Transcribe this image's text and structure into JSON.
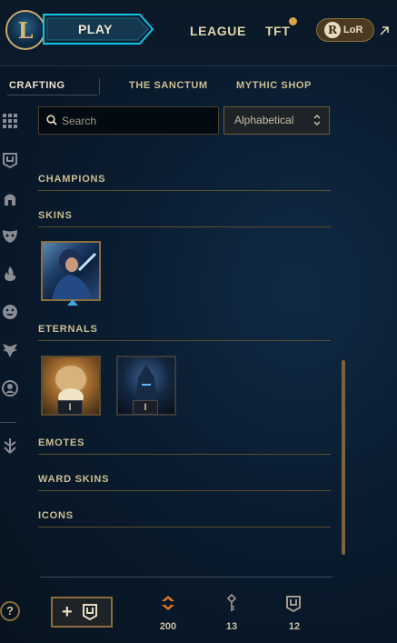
{
  "header": {
    "play_label": "PLAY",
    "nav": [
      {
        "label": "LEAGUE"
      },
      {
        "label": "TFT"
      }
    ],
    "lor_label": "LoR",
    "lor_badge": "R"
  },
  "subnav": {
    "tabs": [
      {
        "label": "CRAFTING",
        "active": true
      },
      {
        "label": "THE SANCTUM",
        "active": false
      },
      {
        "label": "MYTHIC SHOP",
        "active": false
      }
    ]
  },
  "search": {
    "placeholder": "Search",
    "sort_value": "Alphabetical"
  },
  "sections": [
    {
      "title": "CHAMPIONS"
    },
    {
      "title": "SKINS"
    },
    {
      "title": "ETERNALS"
    },
    {
      "title": "EMOTES"
    },
    {
      "title": "WARD SKINS"
    },
    {
      "title": "ICONS"
    }
  ],
  "eternals": [
    {
      "tier": "I"
    },
    {
      "tier": "I"
    }
  ],
  "footer": {
    "help_label": "?",
    "add_label": "+",
    "currencies": [
      {
        "icon": "orange-essence-icon",
        "value": "200",
        "color": "#e07b24"
      },
      {
        "icon": "key-icon",
        "value": "13",
        "color": "#a09b8c"
      },
      {
        "icon": "chest-icon",
        "value": "12",
        "color": "#a09b8c"
      }
    ]
  },
  "colors": {
    "gold": "#c8aa6e",
    "accent_blue": "#3fa7e0",
    "background": "#0a1c30"
  }
}
